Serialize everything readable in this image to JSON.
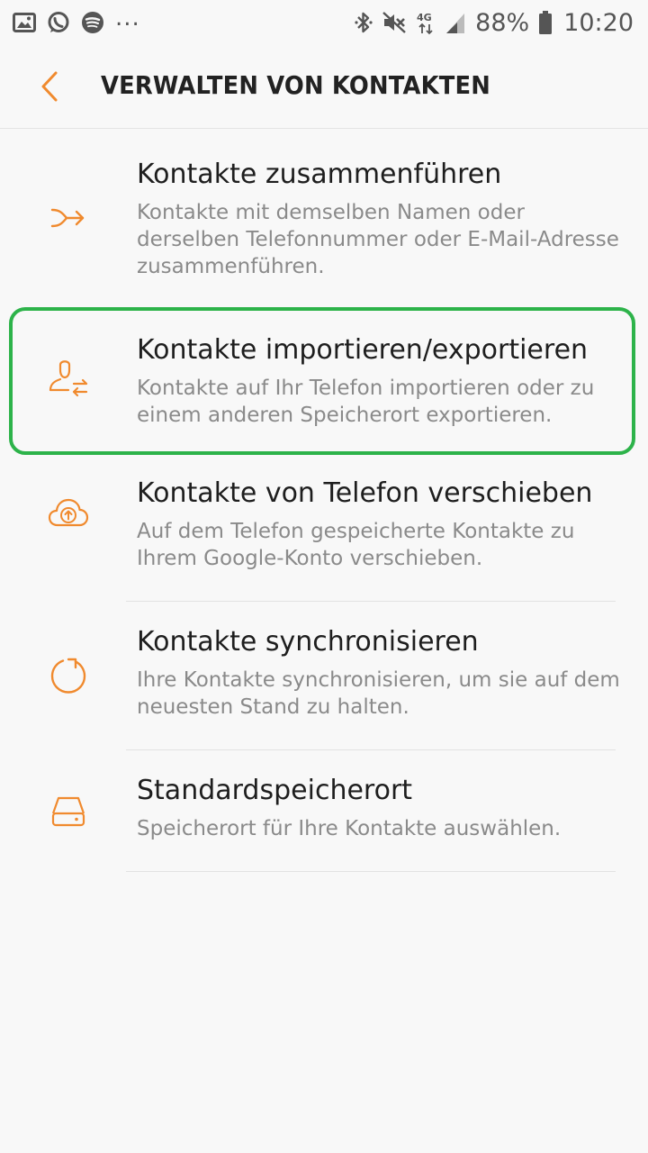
{
  "status_bar": {
    "left_icons": [
      "gallery-icon",
      "whatsapp-icon",
      "spotify-icon"
    ],
    "more": "...",
    "right_icons": [
      "bluetooth-icon",
      "mute-icon",
      "network-4g-icon",
      "signal-icon",
      "battery-icon"
    ],
    "network_label": "4G",
    "battery": "88%",
    "time": "10:20"
  },
  "header": {
    "title": "VERWALTEN VON KONTAKTEN",
    "back_icon": "back-arrow-icon"
  },
  "colors": {
    "accent": "#f08a2e",
    "highlight": "#2db34a",
    "title_text": "#1e1e1e",
    "secondary_text": "#8a8a8a",
    "background": "#f8f8f8"
  },
  "items": [
    {
      "icon": "merge-icon",
      "title": "Kontakte zusammenführen",
      "description": "Kontakte mit demselben Namen oder derselben Telefonnummer oder E-Mail-Adresse zusammenführen."
    },
    {
      "icon": "import-export-icon",
      "title": "Kontakte importieren/exportieren",
      "description": "Kontakte auf Ihr Telefon importieren oder zu einem anderen Speicherort exportieren."
    },
    {
      "icon": "cloud-upload-icon",
      "title": "Kontakte von Telefon verschieben",
      "description": "Auf dem Telefon gespeicherte Kontakte zu Ihrem Google-Konto verschieben."
    },
    {
      "icon": "sync-icon",
      "title": "Kontakte synchronisieren",
      "description": "Ihre Kontakte synchronisieren, um sie auf dem neuesten Stand zu halten."
    },
    {
      "icon": "storage-icon",
      "title": "Standardspeicherort",
      "description": "Speicherort für Ihre Kontakte auswählen."
    }
  ]
}
